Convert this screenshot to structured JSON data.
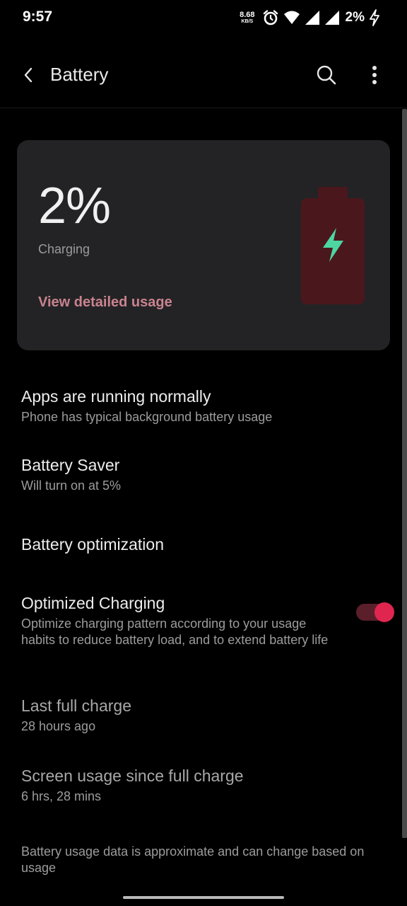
{
  "status_bar": {
    "time": "9:57",
    "net_speed_value": "8.68",
    "net_speed_unit": "KB/S",
    "battery_percent": "2%",
    "icons": [
      "alarm-icon",
      "wifi-icon",
      "signal-icon",
      "signal-icon",
      "charging-bolt-icon"
    ]
  },
  "app_bar": {
    "title": "Battery",
    "icons": [
      "back-arrow-icon",
      "search-icon",
      "more-vert-icon"
    ]
  },
  "battery_card": {
    "percent": "2%",
    "status": "Charging",
    "link": "View detailed usage",
    "level_fraction": 0.02,
    "colors": {
      "battery_body": "#4a171d",
      "bolt": "#4dd6a2",
      "link": "#c9838f"
    }
  },
  "items": {
    "apps_running": {
      "title": "Apps are running normally",
      "subtitle": "Phone has typical background battery usage"
    },
    "battery_saver": {
      "title": "Battery Saver",
      "subtitle": "Will turn on at 5%"
    },
    "battery_optimization": {
      "title": "Battery optimization"
    },
    "optimized_charging": {
      "title": "Optimized Charging",
      "subtitle": "Optimize charging pattern according to your usage habits to reduce battery load, and to extend battery life",
      "enabled": true,
      "toggle_color": "#e0264f"
    },
    "last_full_charge": {
      "title": "Last full charge",
      "subtitle": "28 hours ago"
    },
    "screen_usage": {
      "title": "Screen usage since full charge",
      "subtitle": "6 hrs, 28 mins"
    }
  },
  "footer_note": "Battery usage data is approximate and can change based on usage"
}
